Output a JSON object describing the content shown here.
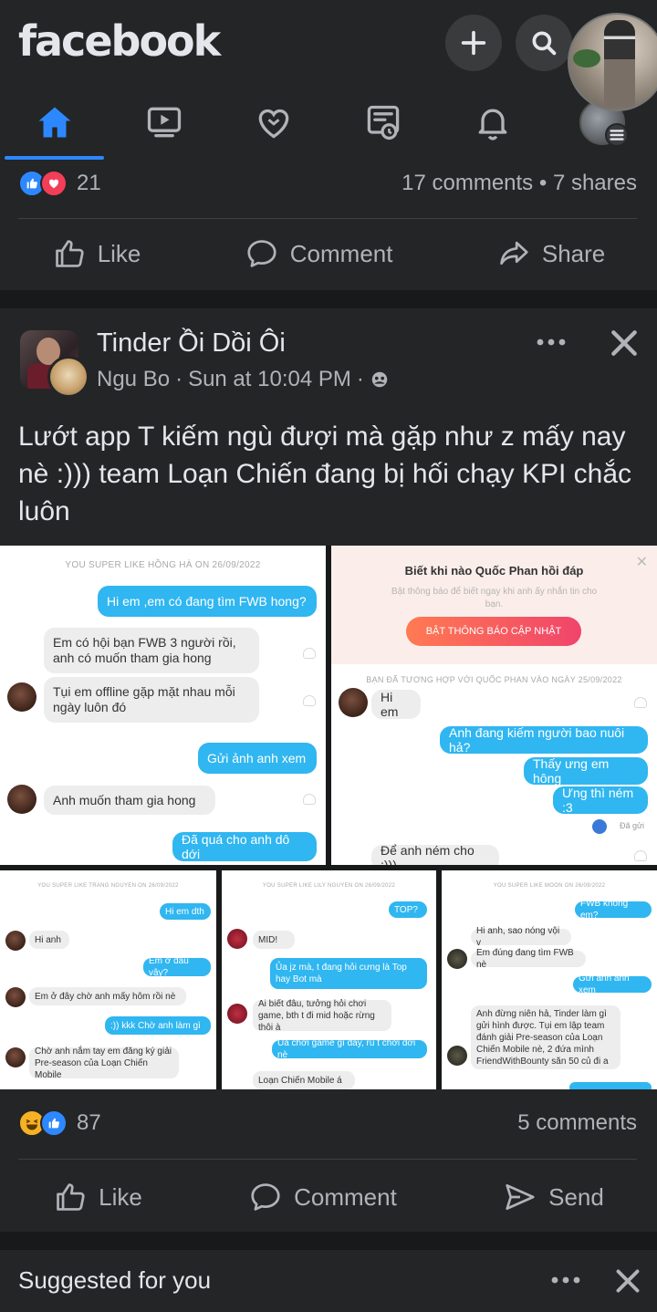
{
  "app": {
    "logo": "facebook"
  },
  "topbar": {
    "add_icon": "plus-icon",
    "search_icon": "search-icon",
    "nav": [
      "home-icon",
      "watch-icon",
      "dating-heart-icon",
      "feeds-icon",
      "notifications-bell-icon",
      "profile-menu-icon"
    ],
    "active_tab": "home",
    "accent": "#2d88ff"
  },
  "post1": {
    "reaction_count": "21",
    "comments": "17 comments",
    "separator": "•",
    "shares": "7 shares",
    "actions": {
      "like": "Like",
      "comment": "Comment",
      "share": "Share"
    }
  },
  "post2": {
    "group": "Tinder Ồi Dồi Ôi",
    "author": "Ngu Bo",
    "time": "Sun at 10:04 PM",
    "dot": "·",
    "text": "Lướt app T kiếm ngù đượi mà gặp như z mấy nay nè :))) team Loạn Chiến đang bị hối chạy KPI chắc luôn",
    "photos": {
      "shot1": {
        "header": "YOU SUPER LIKE HỒNG HÀ ON 26/09/2022",
        "messages": [
          "Hi em ,em có đang tìm FWB hong?",
          "Em có hội bạn FWB 3 người rồi, anh có muốn tham gia hong",
          "Tụi em offline gặp mặt nhau mỗi ngày luôn đó",
          "Gửi ảnh anh xem",
          "Anh muốn tham gia hong",
          "Đã quá cho anh dô dới"
        ]
      },
      "shot2": {
        "banner_title": "Biết khi nào Quốc Phan hồi đáp",
        "banner_sub": "Bật thông báo để biết ngay khi anh ấy nhắn tin cho bạn.",
        "banner_button": "BẬT THÔNG BÁO CẬP NHẬT",
        "header": "BẠN ĐÃ TƯƠNG HỢP VỚI QUỐC PHAN VÀO NGÀY 25/09/2022",
        "messages": [
          "Hi em",
          "Anh đang kiếm người bao nuôi hả?",
          "Thấy ưng em hông",
          "Ưng thì ném :3",
          "Đã gửi",
          "Để anh ném cho :)))"
        ]
      },
      "shot3": {
        "header": "YOU SUPER LIKE TRANG NGUYEN ON 26/09/2022",
        "messages": [
          "Hi em dth",
          "Hi anh",
          "Em ở đâu vậy?",
          "Em ở đây chờ anh mấy hôm rồi nè",
          ":)) kkk Chờ anh làm gì",
          "Chờ anh nắm tay em đăng ký giải Pre-season của Loạn Chiến Mobile"
        ]
      },
      "shot4": {
        "header": "YOU SUPER LIKE LILY NGUYEN ON 26/09/2022",
        "messages": [
          "TOP?",
          "MID!",
          "Ủa jz mà, t đang hỏi cưng là Top hay Bot mà",
          "Ai biết đâu, tưởng hỏi chơi game, bth t đi mid hoặc rừng thôi à",
          "Ủa chơi game gì đây, rủ t chơi dới nè",
          "Loạn Chiến Mobile á"
        ]
      },
      "shot5": {
        "header": "YOU SUPER LIKE MOON ON 26/09/2022",
        "messages": [
          "FWB không em?",
          "Hi anh, sao nóng vội v",
          "Em đúng đang tìm FWB nè",
          "Gửi ảnh anh xem",
          "Anh đừng niên hả, Tinder làm gì gửi hình được. Tụi em lập team đánh giải Pre-season của Loạn Chiến Mobile nè, 2 đứa mình FriendWithBounty săn 50 củ đi a"
        ]
      }
    },
    "reaction_count": "87",
    "comments": "5 comments",
    "actions": {
      "like": "Like",
      "comment": "Comment",
      "send": "Send"
    }
  },
  "suggested": {
    "title": "Suggested for you"
  }
}
